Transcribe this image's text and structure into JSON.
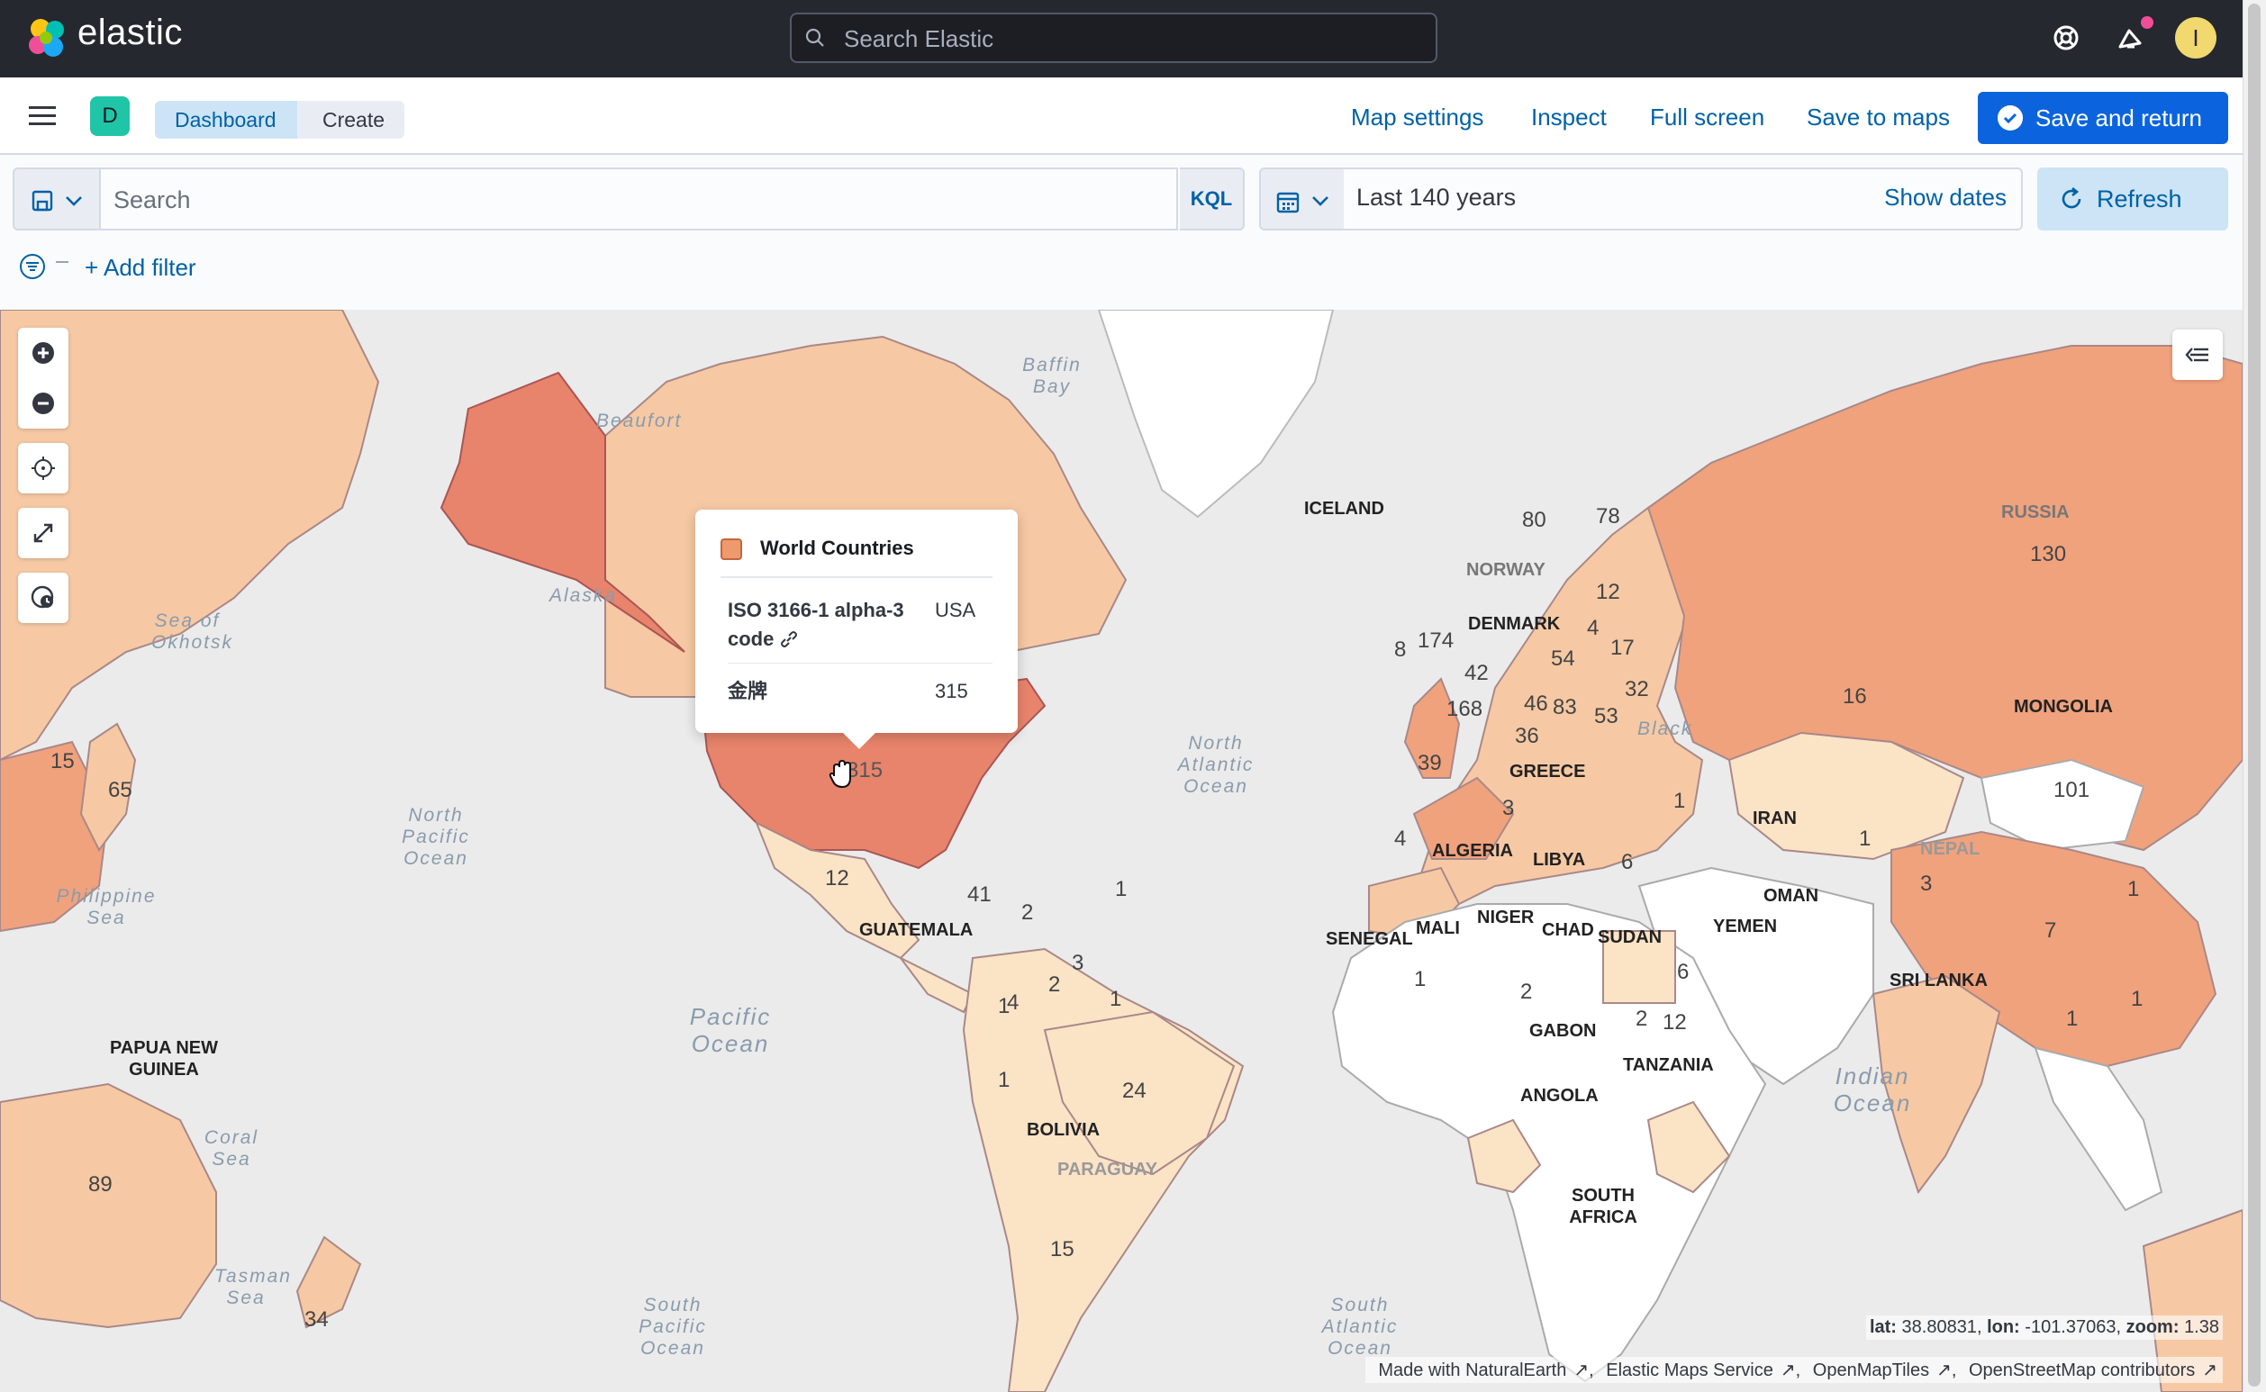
{
  "header": {
    "logo_text": "elastic",
    "search_placeholder": "Search Elastic",
    "avatar_initial": "I"
  },
  "appbar": {
    "space_initial": "D",
    "breadcrumbs": [
      "Dashboard",
      "Create"
    ],
    "links": {
      "map_settings": "Map settings",
      "inspect": "Inspect",
      "full_screen": "Full screen",
      "save_to_maps": "Save to maps"
    },
    "save_and_return": "Save and return"
  },
  "querybar": {
    "search_placeholder": "Search",
    "language": "KQL",
    "date_range": "Last 140 years",
    "show_dates": "Show dates",
    "refresh": "Refresh",
    "add_filter": "+ Add filter"
  },
  "tooltip": {
    "layer_name": "World Countries",
    "rows": [
      {
        "key": "ISO 3166-1 alpha-3 code",
        "value": "USA"
      },
      {
        "key": "金牌",
        "value": "315"
      }
    ]
  },
  "map": {
    "coords": {
      "lat_label": "lat:",
      "lat": "38.80831",
      "lon_label": "lon:",
      "lon": "-101.37063",
      "zoom_label": "zoom:",
      "zoom": "1.38"
    },
    "attribution": [
      "Made with NaturalEarth",
      "Elastic Maps Service",
      "OpenMapTiles",
      "OpenStreetMap contributors"
    ],
    "country_labels": [
      "ICELAND",
      "RUSSIA",
      "NORWAY",
      "DENMARK",
      "MONGOLIA",
      "GREECE",
      "IRAN",
      "ALGERIA",
      "LIBYA",
      "OMAN",
      "YEMEN",
      "SUDAN",
      "CHAD",
      "NIGER",
      "MALI",
      "SENEGAL",
      "GABON",
      "TANZANIA",
      "ANGOLA",
      "SOUTH AFRICA",
      "SRI LANKA",
      "NEPAL",
      "GUATEMALA",
      "BOLIVIA",
      "PARAGUAY",
      "PAPUA NEW GUINEA"
    ],
    "sea_labels": [
      "Baffin Bay",
      "Beaufort",
      "Sea of Okhotsk",
      "Alaska",
      "North Pacific Ocean",
      "Philippine Sea",
      "North Atlantic Ocean",
      "Pacific Ocean",
      "Coral Sea",
      "Tasman Sea",
      "South Pacific Ocean",
      "South Atlantic Ocean",
      "Indian Ocean",
      "Black"
    ],
    "medal_counts": [
      "130",
      "80",
      "78",
      "12",
      "174",
      "8",
      "42",
      "4",
      "17",
      "54",
      "32",
      "168",
      "46",
      "83",
      "53",
      "36",
      "39",
      "16",
      "101",
      "3",
      "6",
      "4",
      "1",
      "3",
      "1",
      "1",
      "2",
      "2",
      "6",
      "12",
      "24",
      "15",
      "12",
      "41",
      "2",
      "3",
      "4",
      "2",
      "1",
      "1",
      "15",
      "65",
      "89",
      "34",
      "7",
      "1",
      "1",
      "1",
      "1",
      "1",
      "315"
    ]
  },
  "colors": {
    "usa_fill": "#e8846b",
    "high_fill": "#f0a27d",
    "mid_fill": "#f6c9a4",
    "low_fill": "#fbe3c6",
    "accent": "#0b64dd"
  }
}
